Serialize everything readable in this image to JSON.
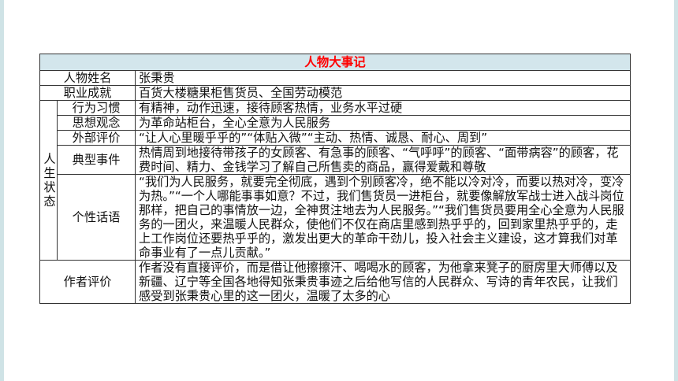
{
  "title": "人物大事记",
  "rows": {
    "name": {
      "label": "人物姓名",
      "value": "张秉贵"
    },
    "career": {
      "label": "职业成就",
      "value": "百货大楼糖果柜售货员、全国劳动模范"
    },
    "life_state": {
      "label": "人生状态",
      "items": [
        {
          "label": "行为习惯",
          "value": "有精神，动作迅速，接待顾客热情，业务水平过硬"
        },
        {
          "label": "思想观念",
          "value": "为革命站柜台，全心全意为人民服务"
        },
        {
          "label": "外部评价",
          "value": "“让人心里暖乎乎的”“体贴入微”“主动、热情、诚恳、耐心、周到”"
        },
        {
          "label": "典型事件",
          "value": "热情周到地接待带孩子的女顾客、有急事的顾客、“气呼呼”的顾客、“面带病容”的顾客，花费时间、精力、金钱学习了解自己所售卖的商品，赢得爱戴和尊敬"
        },
        {
          "label": "个性话语",
          "value": "“我们为人民服务，就要完全彻底，遇到个别顾客冷，绝不能以冷对冷，而要以热对冷，变冷为热。”“一个人哪能事事如意？不过，我们售货员一进柜台，就要像解放军战士进入战斗岗位那样，把自己的事情放一边，全神贯注地去为人民服务。”“我们售货员要用全心全意为人民服务的一团火，来温暖人民群众，使他们不仅在商店里感到热乎乎的，回到家里热乎乎的，走上工作岗位还要热乎乎的，激发出更大的革命干劲儿，投入社会主义建设，这才算我们对革命事业有了一点儿贡献。”"
        }
      ]
    },
    "author_eval": {
      "label": "作者评价",
      "value": "作者没有直接评价，而是借让他擦擦汗、喝喝水的顾客，为他拿来凳子的厨房里大师傅以及新疆、辽宁等全国各地得知张秉贵事迹之后给他写信的人民群众、写诗的青年农民，让我们感受到张秉贵心里的这一团火，温暖了太多的心"
    }
  },
  "colors": {
    "title_text": "#ff0000",
    "title_bg": "#d3e6ec",
    "border": "#333333",
    "side_bar": "#cfe3e6"
  }
}
